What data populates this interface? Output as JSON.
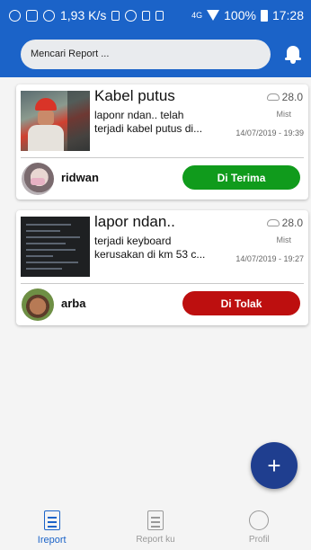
{
  "status_bar": {
    "network_speed": "1,93 K/s",
    "network_type": "4G",
    "battery": "100%",
    "time": "17:28"
  },
  "search": {
    "value": "Mencari Report ..."
  },
  "reports": [
    {
      "title": "Kabel putus",
      "desc_line1": "laponr ndan.. telah",
      "desc_line2": "terjadi kabel putus di...",
      "temperature": "28.0",
      "weather": "Mist",
      "datetime": "14/07/2019 - 19:39",
      "user": "ridwan",
      "status": "Di Terima",
      "status_color": "#109b1c"
    },
    {
      "title": "lapor ndan..",
      "desc_line1": "terjadi keyboard",
      "desc_line2": "kerusakan di km 53 c...",
      "temperature": "28.0",
      "weather": "Mist",
      "datetime": "14/07/2019 - 19:27",
      "user": "arba",
      "status": "Di Tolak",
      "status_color": "#bd0f0f"
    }
  ],
  "fab": {
    "label": "+"
  },
  "nav": [
    {
      "label": "Ireport",
      "icon": "clipboard-icon",
      "active": true
    },
    {
      "label": "Report ku",
      "icon": "report-list-icon",
      "active": false
    },
    {
      "label": "Profil",
      "icon": "profile-icon",
      "active": false
    }
  ],
  "colors": {
    "primary": "#1b63c8",
    "fab": "#1f3e8f"
  }
}
